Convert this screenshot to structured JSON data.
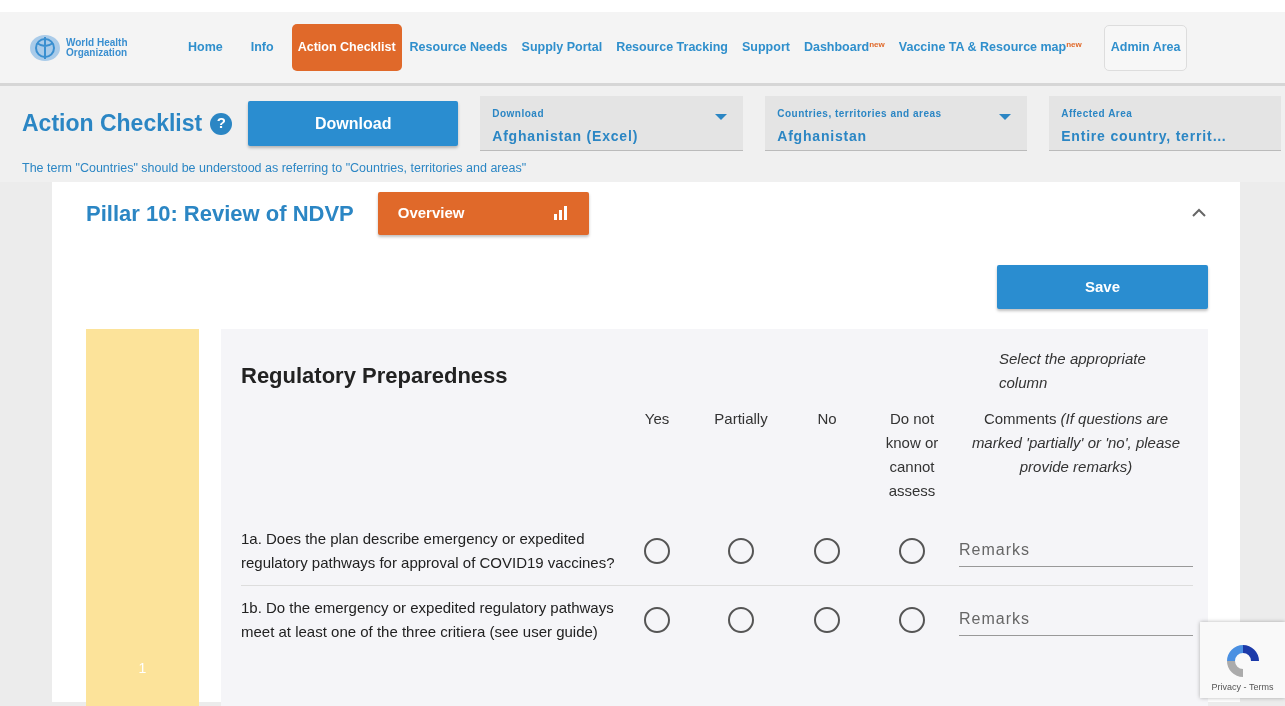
{
  "nav": {
    "logo": [
      "World Health",
      "Organization"
    ],
    "items": [
      {
        "label": "Home",
        "selected": false,
        "kind": "link"
      },
      {
        "label": "Info",
        "selected": false,
        "kind": "link"
      },
      {
        "label": "Action Checklist",
        "selected": true,
        "kind": "link"
      },
      {
        "label": "Resource Needs",
        "selected": false,
        "kind": "link"
      },
      {
        "label": "Supply Portal",
        "selected": false,
        "kind": "link"
      },
      {
        "label": "Resource Tracking",
        "selected": false,
        "kind": "link"
      },
      {
        "label": "Support",
        "selected": false,
        "kind": "link"
      },
      {
        "label": "Dashboard",
        "selected": false,
        "kind": "link",
        "badge": "new"
      },
      {
        "label": "Vaccine TA & Resource map",
        "selected": false,
        "kind": "link",
        "badge": "new"
      },
      {
        "label": "Admin Area",
        "selected": false,
        "kind": "boxed"
      }
    ]
  },
  "header": {
    "title": "Action Checklist",
    "help": "?",
    "download_button": "Download",
    "dropdowns": [
      {
        "label": "Download",
        "value": "Afghanistan (Excel)",
        "caret": true
      },
      {
        "label": "Countries, territories and areas",
        "value": "Afghanistan",
        "caret": true
      },
      {
        "label": "Affected Area",
        "value": "Entire country, territ…",
        "caret": false
      }
    ],
    "note": "The term \"Countries\" should be understood as referring to \"Countries, territories and areas\""
  },
  "pillar": {
    "title": "Pillar 10: Review of NDVP",
    "overview_button": "Overview",
    "expanded": true,
    "save_button": "Save",
    "section": {
      "number": "1",
      "title": "Regulatory Preparedness",
      "instruction": "Select the appropriate column",
      "columns": [
        "Yes",
        "Partially",
        "No",
        "Do not know or cannot assess"
      ],
      "comments_column": "Comments *(If questions are marked 'partially' or 'no', please provide remarks)*",
      "questions": [
        {
          "text": "1a. Does the plan describe emergency or expedited regulatory pathways for approval of COVID19 vaccines?",
          "answers": [
            {
              "selected": false
            },
            {
              "selected": false
            },
            {
              "selected": false
            },
            {
              "selected": false
            }
          ],
          "placeholder": "Remarks"
        },
        {
          "text": "1b. Do the emergency or expedited regulatory pathways meet at least one of the three critiera (see user guide)",
          "answers": [
            {
              "selected": false
            },
            {
              "selected": false
            },
            {
              "selected": false
            },
            {
              "selected": false
            }
          ],
          "placeholder": "Remarks"
        }
      ]
    }
  },
  "recaptcha": {
    "links": "Privacy - Terms"
  }
}
